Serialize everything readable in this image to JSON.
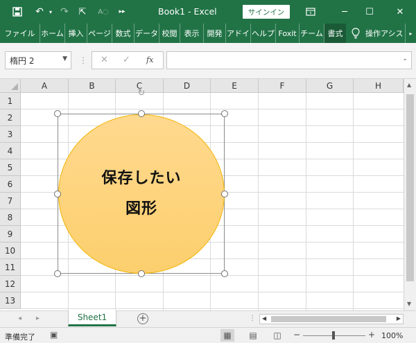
{
  "titlebar": {
    "title": "Book1  -  Excel",
    "signin_label": "サインイン",
    "qa_icons": [
      "save-icon",
      "undo-icon",
      "redo-icon",
      "pointer-icon",
      "read-aloud-icon",
      "more-icon"
    ],
    "window_icons": [
      "ribbon-display-icon",
      "minimize-icon",
      "maximize-icon",
      "close-icon"
    ]
  },
  "ribbon": {
    "tabs": [
      {
        "label": "ファイル"
      },
      {
        "label": "ホーム"
      },
      {
        "label": "挿入"
      },
      {
        "label": "ページ"
      },
      {
        "label": "数式"
      },
      {
        "label": "データ"
      },
      {
        "label": "校閲"
      },
      {
        "label": "表示"
      },
      {
        "label": "開発"
      },
      {
        "label": "アドイ"
      },
      {
        "label": "ヘルプ"
      },
      {
        "label": "Foxit"
      },
      {
        "label": "チーム"
      },
      {
        "label": "書式"
      },
      {
        "label": "操作アシス"
      }
    ],
    "active_tab": "書式"
  },
  "formula_bar": {
    "name_box": "楕円 2",
    "fx_label": "fx",
    "formula_value": ""
  },
  "grid": {
    "columns": [
      "A",
      "B",
      "C",
      "D",
      "E",
      "F",
      "G",
      "H"
    ],
    "rows": [
      "1",
      "2",
      "3",
      "4",
      "5",
      "6",
      "7",
      "8",
      "9",
      "10",
      "11",
      "12",
      "13"
    ]
  },
  "shape": {
    "type": "ellipse",
    "line1": "保存したい",
    "line2": "図形",
    "fill_top": "#ffd98f",
    "fill_bottom": "#fccf6d",
    "border_color": "#f2b400"
  },
  "sheets": {
    "tabs": [
      "Sheet1"
    ],
    "active": "Sheet1"
  },
  "status": {
    "text": "準備完了",
    "zoom": "100%"
  },
  "colors": {
    "accent": "#217346"
  }
}
